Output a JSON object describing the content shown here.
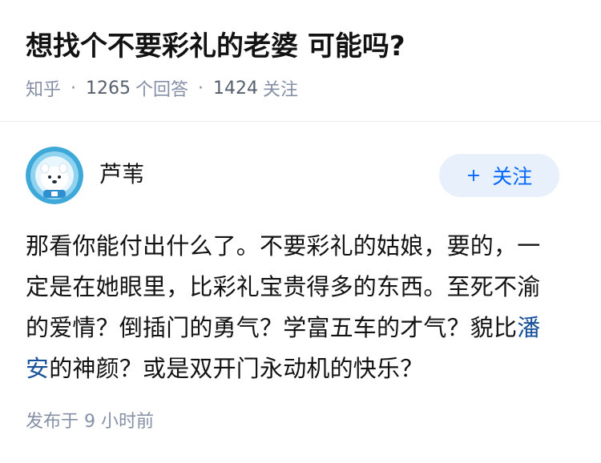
{
  "question": {
    "title": "想找个不要彩礼的老婆 可能吗?",
    "source": "知乎",
    "separator": "·",
    "answer_count": "1265",
    "answer_count_label": "个回答",
    "follower_count": "1424",
    "follower_label": "关注"
  },
  "answer": {
    "author": {
      "name": "芦苇",
      "avatar_icon": "cartoon-bear-astronaut-avatar",
      "follow_button_icon": "plus-icon",
      "follow_button_plus": "+",
      "follow_button_label": "关注"
    },
    "content": {
      "text_before_link": "那看你能付出什么了。不要彩礼的姑娘，要的，一定是在她眼里，比彩礼宝贵得多的东西。至死不渝的爱情？倒插门的勇气？学富五车的才气？貌比",
      "link_text": "潘安",
      "text_after_link": "的神颜？或是双开门永动机的快乐？"
    },
    "published": "发布于 9 小时前"
  },
  "colors": {
    "link": "#175199",
    "accent": "#0066ff",
    "follow_bg": "#e8f1fb",
    "meta_gray": "#8590a6"
  }
}
